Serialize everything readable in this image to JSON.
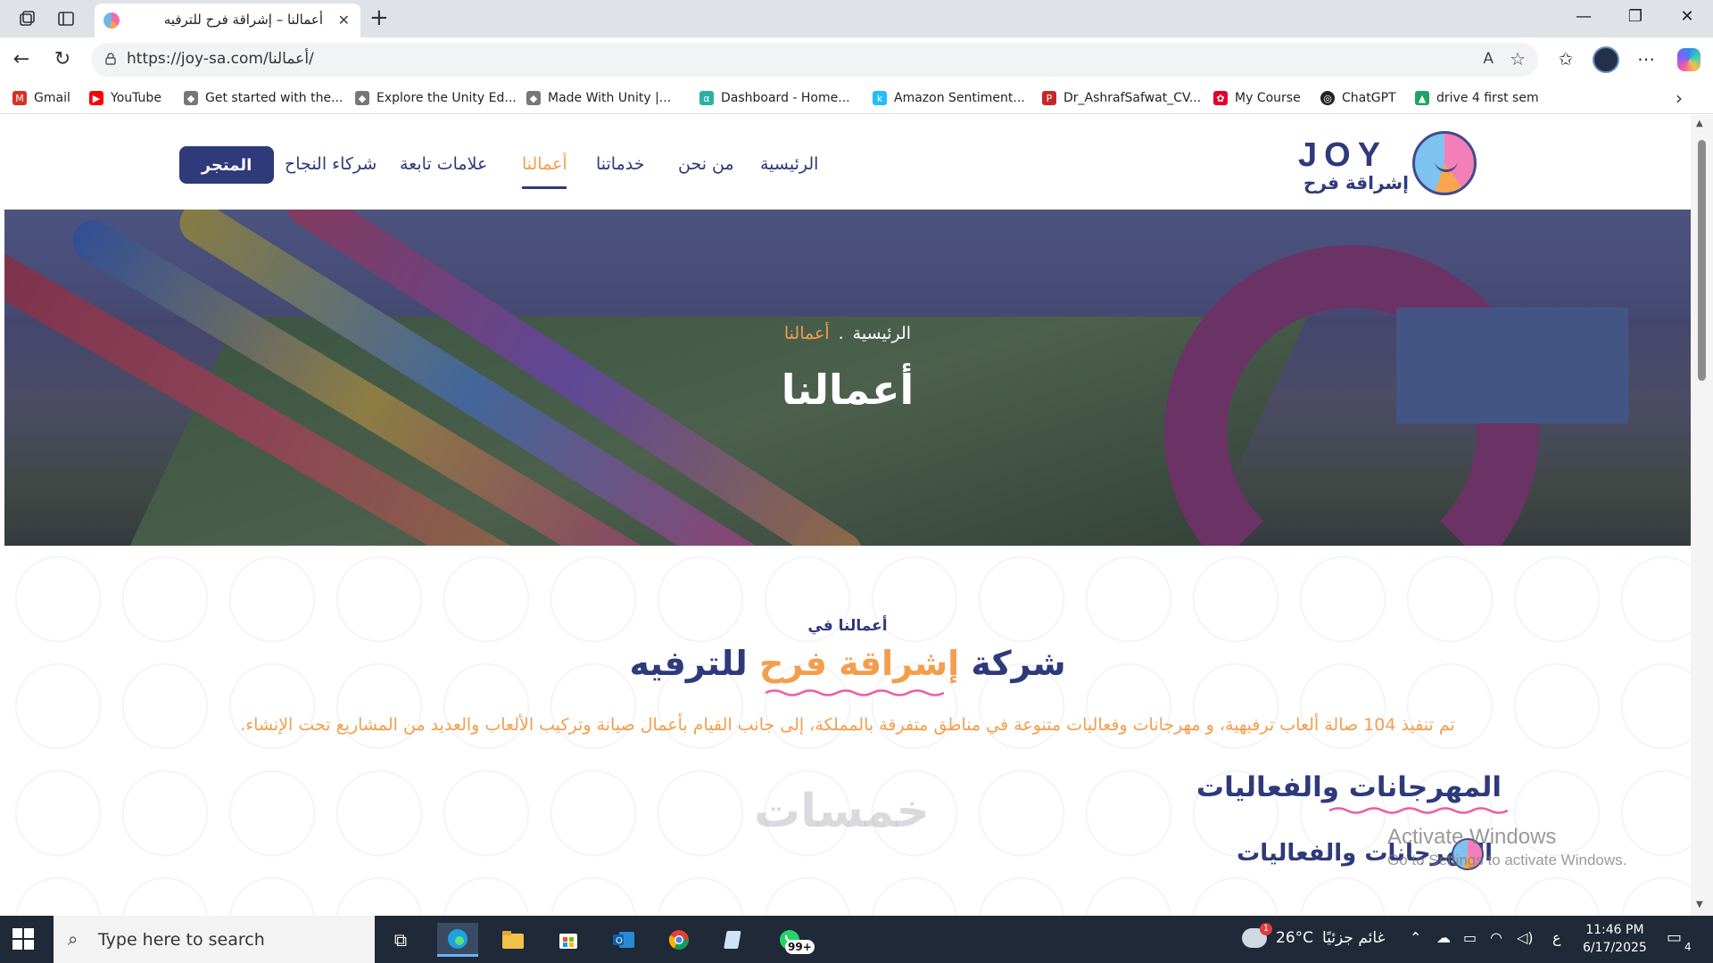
{
  "browser": {
    "tab_title": "أعمالنا – إشراقة فرح للترفيه",
    "url": "https://joy-sa.com/أعمالنا/",
    "read_aloud": "A",
    "bookmarks": [
      {
        "label": "Gmail",
        "icon": "gmail-icon",
        "color": "#d93025"
      },
      {
        "label": "YouTube",
        "icon": "youtube-icon",
        "color": "#ff0000"
      },
      {
        "label": "Get started with the...",
        "icon": "unity-icon",
        "color": "#777777"
      },
      {
        "label": "Explore the Unity Ed...",
        "icon": "unity-icon",
        "color": "#777777"
      },
      {
        "label": "Made With Unity |...",
        "icon": "unity-icon",
        "color": "#777777"
      },
      {
        "label": "Dashboard - Home...",
        "icon": "dashboard-icon",
        "color": "#2ab1a0"
      },
      {
        "label": "Amazon Sentiment...",
        "icon": "kaggle-icon",
        "color": "#20beff"
      },
      {
        "label": "Dr_AshrafSafwat_CV...",
        "icon": "pdf-icon",
        "color": "#c62828"
      },
      {
        "label": "My Course",
        "icon": "huawei-icon",
        "color": "#e4002b"
      },
      {
        "label": "ChatGPT",
        "icon": "chatgpt-icon",
        "color": "#222222"
      },
      {
        "label": "drive 4 first sem",
        "icon": "drive-icon",
        "color": "#1fa463"
      }
    ]
  },
  "site": {
    "logo_word": "JOY",
    "logo_sub": "إشراقة فرح",
    "nav": {
      "home": "الرئيسية",
      "about": "من نحن",
      "services": "خدماتنا",
      "works": "أعمالنا",
      "brands": "علامات تابعة",
      "partners": "شركاء النجاح",
      "store": "المتجر"
    },
    "colors": {
      "primary": "#2e3a7a",
      "accent": "#f39e4c",
      "pink": "#f05aa2"
    },
    "hero": {
      "crumb_home": "الرئيسية",
      "crumb_sep": ".",
      "crumb_current": "أعمالنا",
      "title": "أعمالنا"
    },
    "intro": {
      "eyebrow": "أعمالنا في",
      "headline_1": "شركة",
      "headline_2": "إشراقة فرح",
      "headline_3": "للترفيه",
      "description": "تم تنفيذ 104 صالة ألعاب ترفيهية، و مهرجانات وفعاليات متنوعة في مناطق متفرقة بالمملكة، إلى جانب القيام بأعمال صيانة وتركيب الألعاب والعديد من المشاريع تحت الإنشاء."
    },
    "section": {
      "title": "المهرجانات والفعاليات",
      "subtitle": "المهرجانات والفعاليات"
    },
    "watermark": "خمسات"
  },
  "os": {
    "activate_line1": "Activate Windows",
    "activate_line2": "Go to Settings to activate Windows.",
    "search_placeholder": "Type here to search",
    "weather_temp": "26°C",
    "weather_desc": "غائم جزئيًا",
    "notif_badge": "99+",
    "lang": "ع",
    "time": "11:46 PM",
    "date": "6/17/2025",
    "notification_count": "4"
  }
}
